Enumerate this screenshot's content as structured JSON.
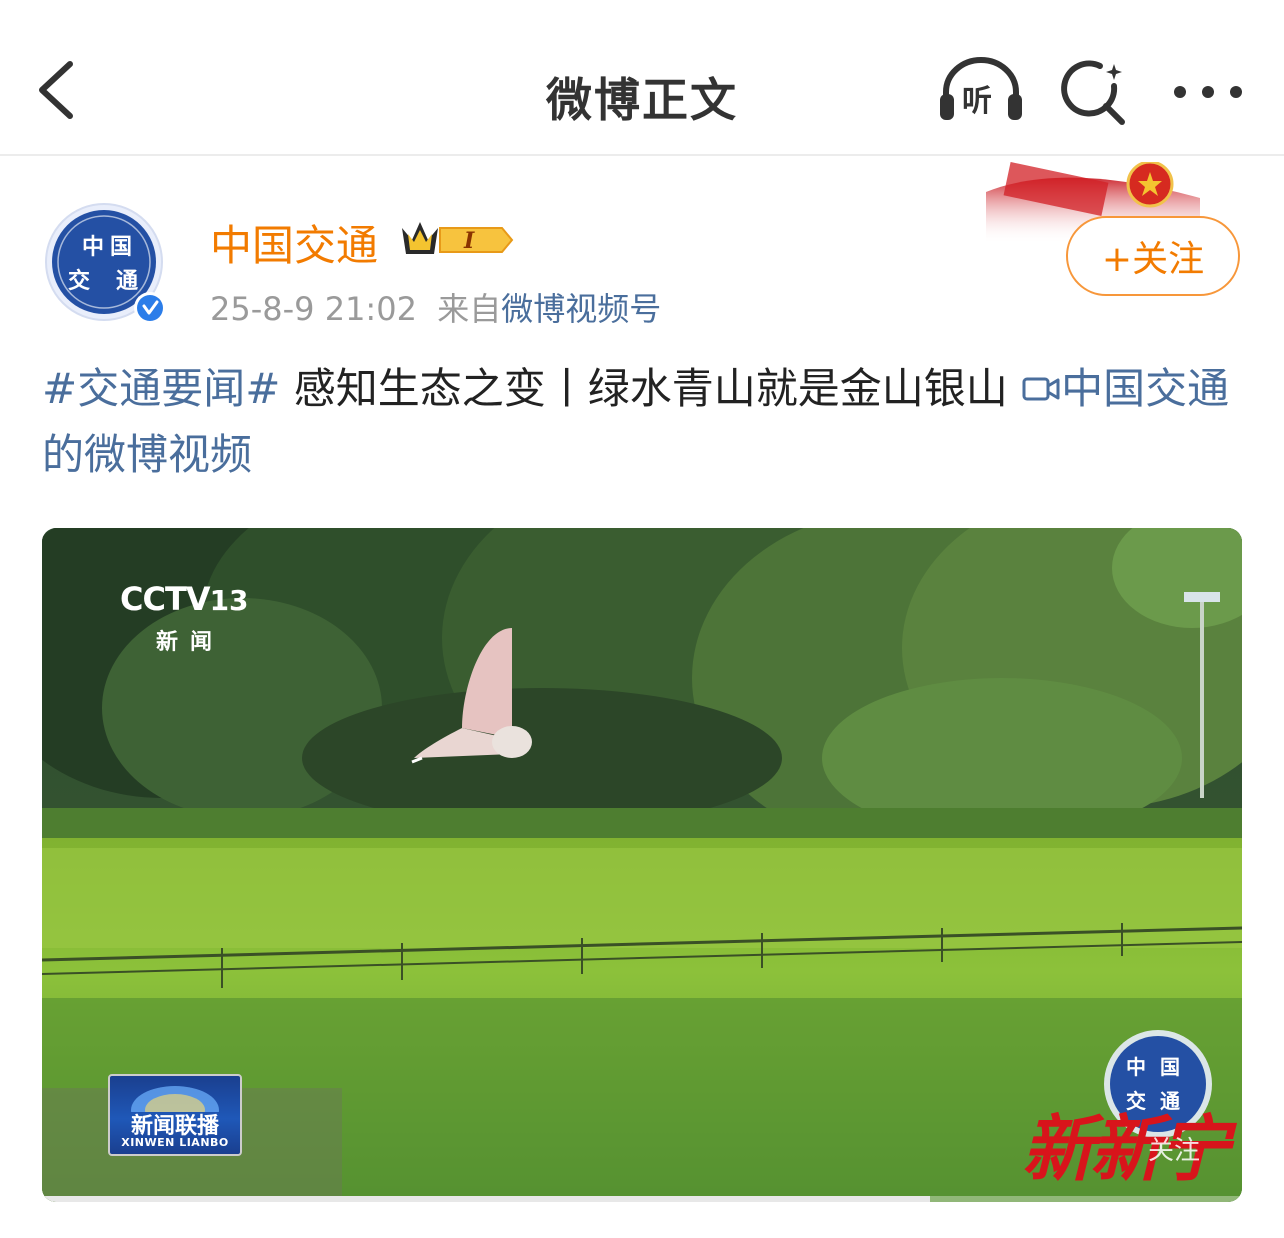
{
  "header": {
    "title": "微博正文",
    "listen_label": "听"
  },
  "author": {
    "name": "中国交通",
    "avatar_text": [
      "中",
      "国",
      "交",
      "通"
    ],
    "badge_level": "I",
    "timestamp": "25-8-9 21:02",
    "source_prefix": "来自",
    "source": "微博视频号",
    "follow_label": "+关注"
  },
  "post": {
    "topic": "#交通要闻#",
    "text": " 感知生态之变丨绿水青山就是金山银山 ",
    "video_link": "中国交通的微博视频"
  },
  "video": {
    "channel_logo": "CCTV",
    "channel_number": "13",
    "channel_sub": "新闻",
    "program_title": "新闻联播",
    "program_en": "XINWEN LIANBO",
    "watermark_text": "新新宁",
    "watermark_follow": "关注",
    "progress": 0.74
  },
  "colors": {
    "accent_orange": "#f27b00",
    "link_blue": "#4a6e9c",
    "meta_gray": "#9a9a9a"
  }
}
